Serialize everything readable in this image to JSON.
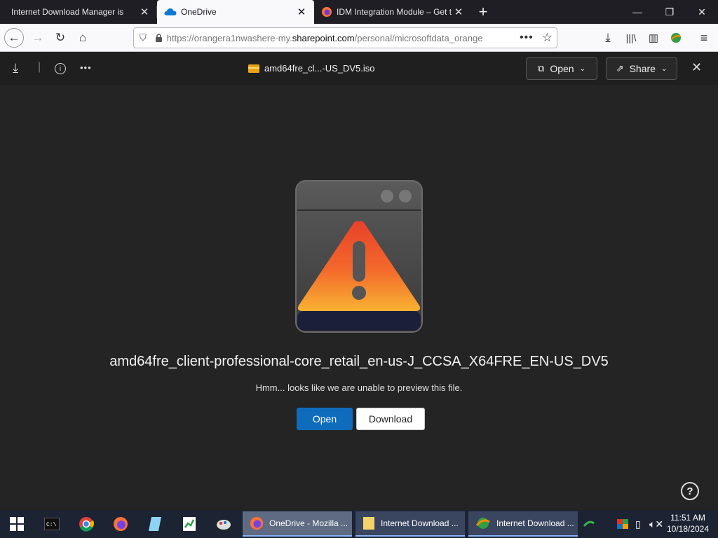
{
  "browser": {
    "tabs": [
      {
        "title": "Internet Download Manager is",
        "icon": "idm-tab-icon"
      },
      {
        "title": "OneDrive",
        "icon": "onedrive-cloud-icon"
      },
      {
        "title": "IDM Integration Module – Get t",
        "icon": "firefox-tab-icon"
      }
    ],
    "url_prefix": "https://orangera1nwashere-my.",
    "url_domain": "sharepoint.com",
    "url_suffix": "/personal/microsoftdata_orange"
  },
  "onedrive": {
    "short_filename": "amd64fre_cl...-US_DV5.iso",
    "open_label": "Open",
    "share_label": "Share",
    "file_title": "amd64fre_client-professional-core_retail_en-us-J_CCSA_X64FRE_EN-US_DV5",
    "message": "Hmm... looks like we are unable to preview this file.",
    "open_button": "Open",
    "download_button": "Download",
    "help": "?"
  },
  "taskbar": {
    "apps": [
      {
        "label": "OneDrive - Mozilla ...",
        "active": true
      },
      {
        "label": "Internet Download ...",
        "active": false
      },
      {
        "label": "Internet Download ...",
        "active": false
      }
    ],
    "time": "11:51 AM",
    "date": "10/18/2024"
  },
  "colors": {
    "accent": "#0f6cbd",
    "background": "#242424"
  }
}
